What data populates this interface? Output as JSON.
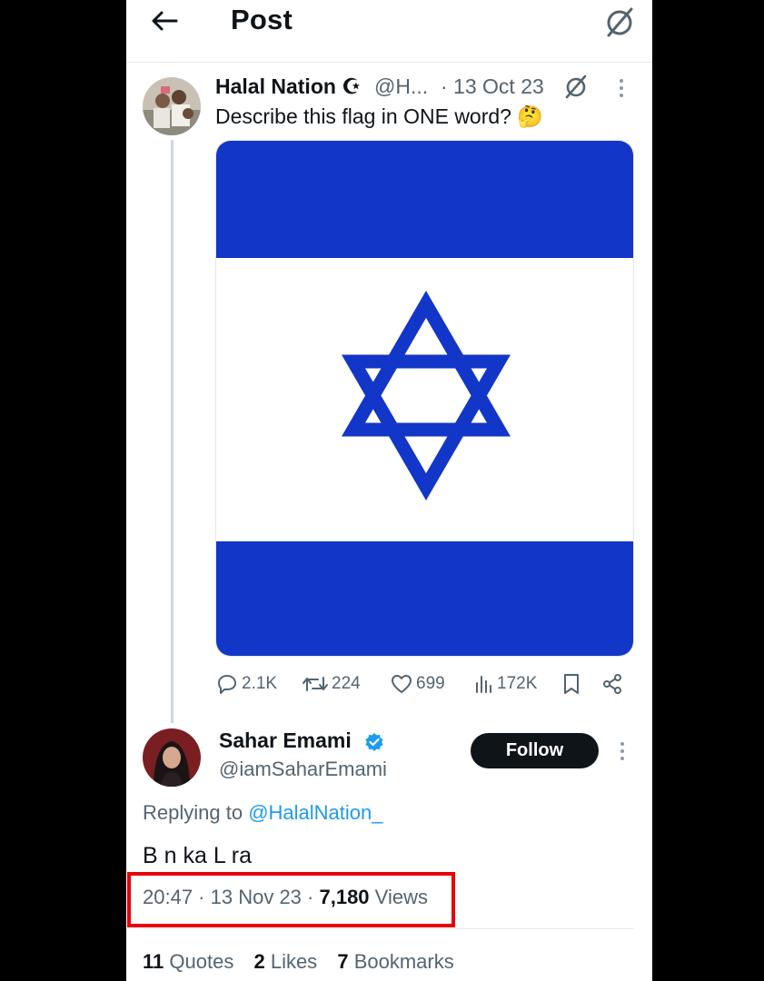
{
  "header": {
    "title": "Post"
  },
  "tweet1": {
    "name": "Halal Nation",
    "handle": "@H...",
    "date": "· 13 Oct 23",
    "text": "Describe this flag in ONE word? 🤔",
    "actions": {
      "replies": "2.1K",
      "reposts": "224",
      "likes": "699",
      "views": "172K"
    }
  },
  "tweet2": {
    "name": "Sahar Emami",
    "handle": "@iamSaharEmami",
    "follow_label": "Follow",
    "replying_prefix": "Replying to",
    "replying_handle": "@HalalNation_",
    "text": "B  n ka L  ra",
    "time": "20:47",
    "date": "13 Nov 23",
    "views_count": "7,180",
    "views_label": "Views",
    "stats": {
      "quotes_count": "11",
      "quotes_label": "Quotes",
      "likes_count": "2",
      "likes_label": "Likes",
      "bookmarks_count": "7",
      "bookmarks_label": "Bookmarks"
    }
  },
  "colors": {
    "accent": "#1d9bf0",
    "flag_blue": "#1236c8",
    "highlight": "#e8000b",
    "text": "#0f1419",
    "muted": "#536471"
  }
}
